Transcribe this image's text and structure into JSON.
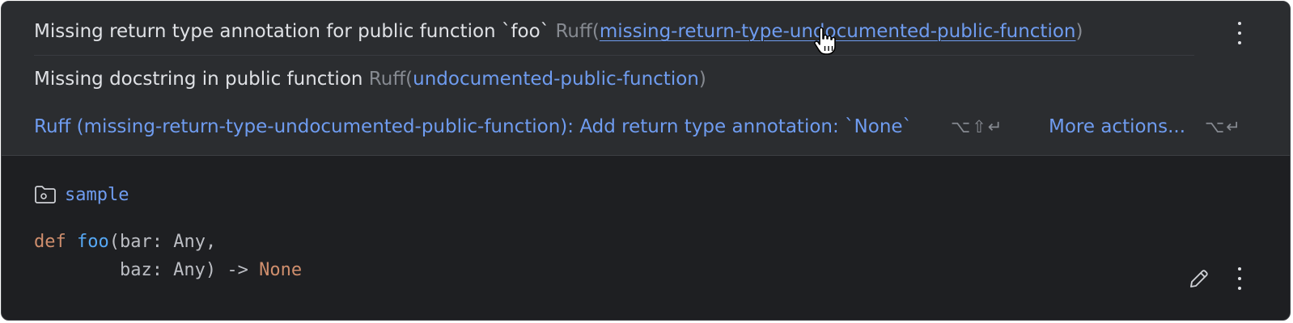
{
  "problems": [
    {
      "message": "Missing return type annotation for public function `foo`",
      "source": "Ruff(",
      "rule": "missing-return-type-undocumented-public-function",
      "close": ")"
    },
    {
      "message": "Missing docstring in public function",
      "source": "Ruff(",
      "rule": "undocumented-public-function",
      "close": ")"
    }
  ],
  "actions": {
    "fix_label": "Ruff (missing-return-type-undocumented-public-function): Add return type annotation: `None`",
    "fix_shortcut": "⌥⇧↵",
    "more_label": "More actions...",
    "more_shortcut": "⌥↵"
  },
  "file": {
    "icon": "folder-icon",
    "name": "sample"
  },
  "code": {
    "line1": {
      "kw": "def",
      "space": " ",
      "fn": "foo",
      "rest": "(bar: Any,"
    },
    "line2": {
      "indent": "        baz: Any) -> ",
      "kw": "None"
    }
  },
  "colors": {
    "link": "#6f9cf0",
    "keyword": "#cf8e6d",
    "function": "#56a8f5",
    "text": "#dfe1e5",
    "muted": "#868a91",
    "header_bg": "#2b2d30",
    "editor_bg": "#1e1f22"
  }
}
